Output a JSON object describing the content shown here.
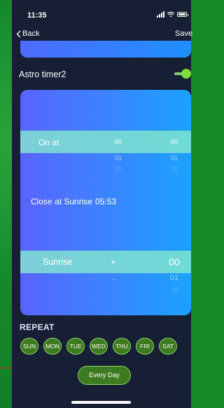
{
  "status": {
    "time": "11:35"
  },
  "nav": {
    "back_label": "Back",
    "save_label": "Save"
  },
  "astro": {
    "label": "Astro timer2",
    "toggle_on": true
  },
  "timer": {
    "on_label": "On at",
    "hour_values": [
      "00",
      "01",
      "02"
    ],
    "minute_values": [
      "00",
      "01",
      "02"
    ],
    "close_label": "Close at Sunrise",
    "close_time": "05:53",
    "event_label": "Sunrise",
    "sign_values": [
      "+",
      "-"
    ],
    "offset_values": [
      "00",
      "01",
      "02"
    ]
  },
  "repeat": {
    "label": "REPEAT",
    "days": [
      "SUN",
      "MON",
      "TUE",
      "WED",
      "THU",
      "FRI",
      "SAT"
    ],
    "every_day_label": "Every Day"
  },
  "colors": {
    "background_green": "#178a2a",
    "app_bg": "#161f33",
    "card_gradient_start": "#5a63ff",
    "card_gradient_end": "#1aa2ff",
    "band": "#82e6cd",
    "day_fill": "#3e7a1f",
    "toggle_on": "#7ddf3d"
  },
  "icons": {
    "back": "chevron-left-icon",
    "signal": "cellular-signal-icon",
    "wifi": "wifi-icon",
    "battery": "battery-icon"
  }
}
